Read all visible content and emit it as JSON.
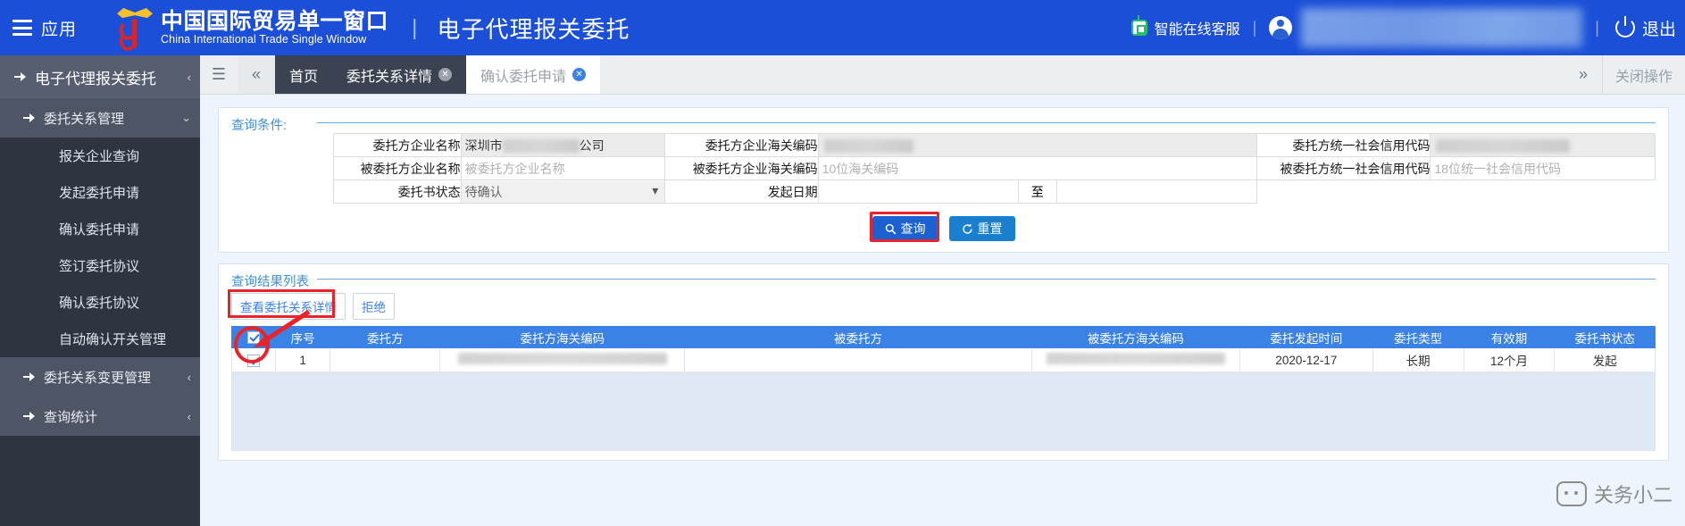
{
  "header": {
    "apps_label": "应用",
    "brand_cn": "中国国际贸易单一窗口",
    "brand_en": "China International Trade Single Window",
    "separator": "|",
    "module_title": "电子代理报关委托",
    "service_label": "智能在线客服",
    "logout_label": "退出",
    "user_name": ""
  },
  "sidebar": {
    "root": "电子代理报关委托",
    "group1": "委托关系管理",
    "items": [
      "报关企业查询",
      "发起委托申请",
      "确认委托申请",
      "签订委托协议",
      "确认委托协议",
      "自动确认开关管理"
    ],
    "group2": "委托关系变更管理",
    "group3": "查询统计"
  },
  "tabbar": {
    "tabs": [
      {
        "label": "首页",
        "closable": false,
        "state": "dark"
      },
      {
        "label": "委托关系详情",
        "closable": true,
        "state": "dark"
      },
      {
        "label": "确认委托申请",
        "closable": true,
        "state": "light"
      }
    ],
    "close_ops_label": "关闭操作",
    "menu_icon": "hamburger-icon",
    "collapse_icon": "double-chevron-left-icon",
    "expand_icon": "double-chevron-right-icon",
    "close_icon": "close-circle-icon"
  },
  "query_panel": {
    "title": "查询条件:",
    "fields": {
      "consignor_name_label": "委托方企业名称",
      "consignor_name_value_prefix": "深圳市",
      "consignor_name_value_suffix": "公司",
      "consignor_customs_code_label": "委托方企业海关编码",
      "consignor_credit_code_label": "委托方统一社会信用代码",
      "consignee_name_label": "被委托方企业名称",
      "consignee_name_placeholder": "被委托方企业名称",
      "consignee_customs_code_label": "被委托方企业海关编码",
      "consignee_customs_code_placeholder": "10位海关编码",
      "consignee_credit_code_label": "被委托方统一社会信用代码",
      "consignee_credit_code_placeholder": "18位统一社会信用代码",
      "status_label": "委托书状态",
      "status_value": "待确认",
      "status_options": [
        "待确认"
      ],
      "start_date_label": "发起日期",
      "date_to_label": "至",
      "start_date_value": "",
      "end_date_value": ""
    },
    "buttons": {
      "search": "查询",
      "reset": "重置",
      "search_icon": "search-icon",
      "reset_icon": "refresh-icon"
    }
  },
  "results_panel": {
    "title": "查询结果列表",
    "actions": [
      {
        "label": "查看委托关系详情",
        "highlighted": true
      },
      {
        "label": "拒绝",
        "highlighted": false
      }
    ],
    "columns": [
      "序号",
      "委托方",
      "委托方海关编码",
      "被委托方",
      "被委托方海关编码",
      "委托发起时间",
      "委托类型",
      "有效期",
      "委托书状态"
    ],
    "rows": [
      {
        "checked": true,
        "index": "1",
        "consignor": "",
        "consignor_code": "",
        "consignee": "",
        "consignee_code": "",
        "start_time": "2020-12-17",
        "type": "长期",
        "validity": "12个月",
        "status": "发起"
      }
    ]
  },
  "watermark": {
    "text": "关务小二",
    "icon": "chat-bubble-icon"
  },
  "colors": {
    "header_blue": "#1b4fd8",
    "sidebar_dark": "#2e3440",
    "accent_blue": "#3b82e6",
    "annotation_red": "#e8232a",
    "panel_bg": "#edf4fb"
  }
}
